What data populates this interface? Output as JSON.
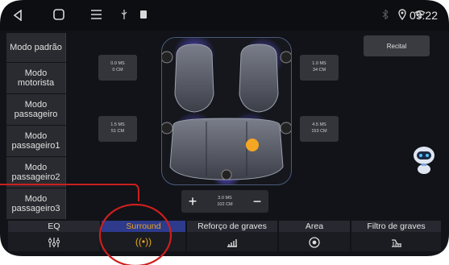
{
  "status": {
    "time": "09:22"
  },
  "presets": [
    {
      "label": "Modo padrão"
    },
    {
      "label": "Modo motorista"
    },
    {
      "label": "Modo passageiro"
    },
    {
      "label": "Modo passageiro1"
    },
    {
      "label": "Modo passageiro2"
    },
    {
      "label": "Modo passageiro3"
    }
  ],
  "delays": {
    "front_left": {
      "ms": "0.0 MS",
      "cm": "0 CM"
    },
    "front_right": {
      "ms": "1.0 MS",
      "cm": "34 CM"
    },
    "rear_left": {
      "ms": "1.5 MS",
      "cm": "51 CM"
    },
    "rear_right": {
      "ms": "4.5 MS",
      "cm": "153 CM"
    }
  },
  "recital": "Recital",
  "stepper": {
    "plus": "+",
    "minus": "−",
    "ms": "3.0 MS",
    "cm": "102 CM"
  },
  "tabs": [
    {
      "label": "EQ",
      "icon": "equalizer-icon",
      "active": false
    },
    {
      "label": "Surround",
      "icon": "surround-icon",
      "active": true
    },
    {
      "label": "Reforço de graves",
      "icon": "bass-boost-icon",
      "active": false
    },
    {
      "label": "Area",
      "icon": "area-target-icon",
      "active": false
    },
    {
      "label": "Filtro de graves",
      "icon": "bass-filter-icon",
      "active": false
    }
  ],
  "colors": {
    "accent": "#e8a81e",
    "annotation": "#cc1f1f",
    "focus_dot": "#f5a623"
  }
}
